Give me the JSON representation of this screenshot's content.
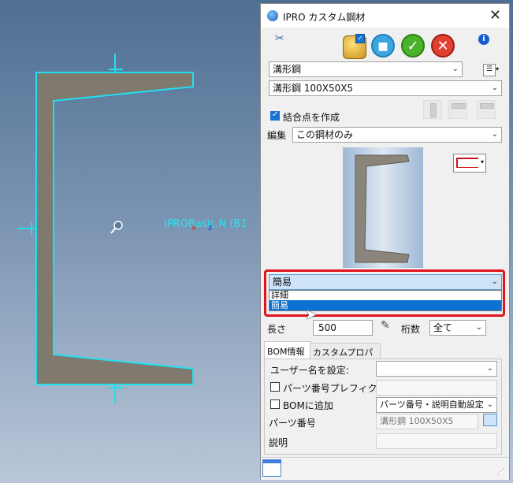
{
  "cad": {
    "part_label": "IPROBasic.N (B1",
    "axis_x": "x",
    "axis_z": "z"
  },
  "panel": {
    "title": "IPRO カスタム鋼材",
    "close_glyph": "✕",
    "info_glyph": "i",
    "category_select": "溝形鋼",
    "size_select": "溝形鋼 100X50X5",
    "create_joint_label": "結合点を作成",
    "create_joint_checked": true,
    "edit_label": "編集",
    "edit_select": "この鋼材のみ",
    "detail_select": "簡易",
    "detail_options": [
      "詳細",
      "簡易"
    ],
    "length_label": "長さ",
    "length_value": "500",
    "digits_label": "桁数",
    "digits_select": "全て",
    "tabs": [
      "BOM情報",
      "カスタムプロパティ"
    ],
    "user_name_label": "ユーザー名を設定:",
    "user_name_value": "",
    "parts_prefix_label": "パーツ番号プレフィクス",
    "parts_prefix_value": "",
    "bom_add_label": "BOMに追加",
    "bom_add_select": "パーツ番号・説明自動設定",
    "part_number_label": "パーツ番号",
    "part_number_value": "溝形鋼 100X50X5",
    "description_label": "説明",
    "description_value": ""
  },
  "colors": {
    "profile_fill": "#807a6e",
    "profile_outline": "#20e0f0",
    "highlight": "#e0141e",
    "selection": "#0b72d4",
    "ok_green": "#4ab32a",
    "cancel_red": "#e0402f",
    "apply_blue": "#3aa6e0"
  }
}
